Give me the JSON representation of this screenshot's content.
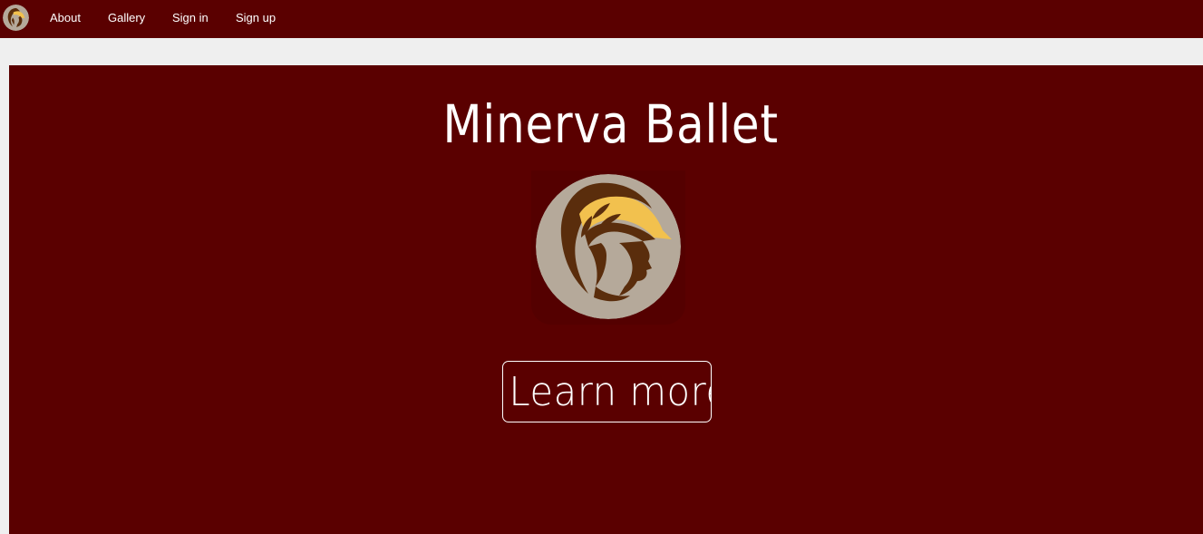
{
  "nav": {
    "logo_icon": "athena-helmet-logo-icon",
    "links": [
      {
        "label": "About"
      },
      {
        "label": "Gallery"
      },
      {
        "label": "Sign in"
      },
      {
        "label": "Sign up"
      }
    ]
  },
  "hero": {
    "title": "Minerva Ballet",
    "emblem_icon": "athena-helmet-emblem-icon",
    "cta_label": "Learn more"
  },
  "colors": {
    "brand": "#5a0000",
    "page_background": "#efefef",
    "text": "#ffffff",
    "emblem_background": "#b5a99a",
    "helmet_dark": "#5a2d0c",
    "helmet_gold": "#f2c14e"
  }
}
